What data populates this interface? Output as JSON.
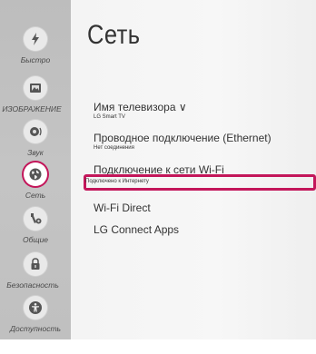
{
  "title": "Сеть",
  "sidebar": {
    "items": [
      {
        "label": "Быстро",
        "icon": "lightning-icon",
        "active": false
      },
      {
        "label": "ИЗОБРАЖЕНИЕ",
        "icon": "picture-icon",
        "active": false
      },
      {
        "label": "Звук",
        "icon": "speaker-icon",
        "active": false
      },
      {
        "label": "Сеть",
        "icon": "globe-icon",
        "active": true
      },
      {
        "label": "Общие",
        "icon": "wrench-gear-icon",
        "active": false
      },
      {
        "label": "Безопасность",
        "icon": "lock-icon",
        "active": false
      },
      {
        "label": "Доступность",
        "icon": "accessibility-icon",
        "active": false
      }
    ]
  },
  "menu": {
    "tv_name": {
      "label": "Имя телевизора ∨",
      "sub": "LG Smart TV"
    },
    "ethernet": {
      "label": "Проводное подключение (Ethernet)",
      "sub": "Нет соединения"
    },
    "wifi": {
      "label": "Подключение к сети Wi-Fi",
      "sub": "Подключено к Интернету"
    },
    "wifi_direct": {
      "label": "Wi-Fi Direct"
    },
    "lg_connect": {
      "label": "LG Connect Apps"
    }
  },
  "colors": {
    "accent": "#c3165a",
    "sidebar_bg": "#c0c0c0",
    "panel_bg": "#f5f5f5",
    "text": "#333333"
  }
}
